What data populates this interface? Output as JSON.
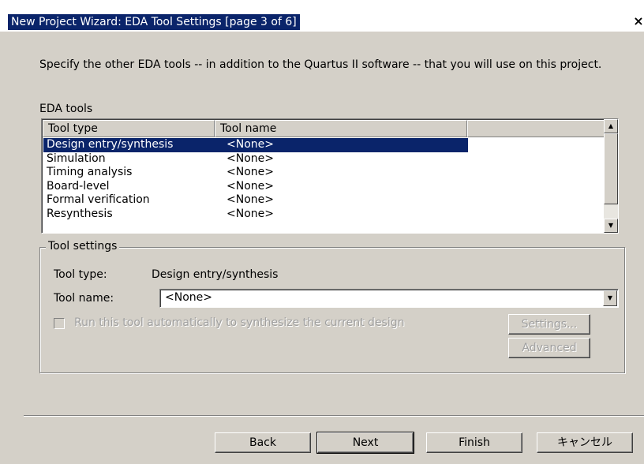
{
  "window": {
    "title": "New Project Wizard: EDA Tool Settings [page 3 of 6]",
    "close_glyph": "×"
  },
  "description": "Specify the other EDA tools -- in addition to the Quartus II software -- that you will use on this project.",
  "eda_tools": {
    "label": "EDA tools",
    "columns": [
      "Tool type",
      "Tool name"
    ],
    "rows": [
      {
        "type": "Design entry/synthesis",
        "name": "<None>",
        "selected": true
      },
      {
        "type": "Simulation",
        "name": "<None>"
      },
      {
        "type": "Timing analysis",
        "name": "<None>"
      },
      {
        "type": "Board-level",
        "name": "<None>"
      },
      {
        "type": "Formal verification",
        "name": "<None>"
      },
      {
        "type": "Resynthesis",
        "name": "<None>"
      }
    ]
  },
  "tool_settings": {
    "legend": "Tool settings",
    "tool_type_label": "Tool type:",
    "tool_type_value": "Design entry/synthesis",
    "tool_name_label": "Tool name:",
    "tool_name_value": "<None>",
    "auto_run_label": "Run this tool automatically to synthesize the current design",
    "settings_button": "Settings...",
    "advanced_button": "Advanced"
  },
  "footer": {
    "back": "Back",
    "next": "Next",
    "finish": "Finish",
    "cancel": "キャンセル"
  },
  "colors": {
    "selection": "#0a246a",
    "dialog_face": "#d4d0c8"
  }
}
